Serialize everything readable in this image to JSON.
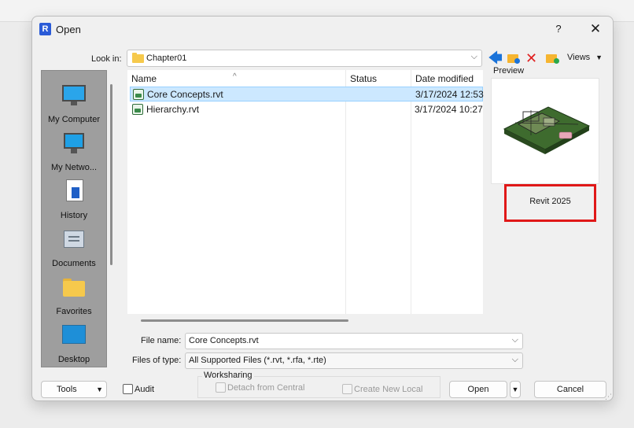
{
  "window": {
    "title": "Open",
    "help": "?",
    "close": "✕"
  },
  "lookin": {
    "label": "Look in:",
    "value": "Chapter01"
  },
  "toolbar": {
    "views_label": "Views"
  },
  "places": [
    {
      "label": "My Computer",
      "icon": "computer-icon"
    },
    {
      "label": "My Netwo...",
      "icon": "network-icon"
    },
    {
      "label": "History",
      "icon": "history-icon"
    },
    {
      "label": "Documents",
      "icon": "documents-icon"
    },
    {
      "label": "Favorites",
      "icon": "favorites-icon"
    },
    {
      "label": "Desktop",
      "icon": "desktop-icon"
    }
  ],
  "filelist": {
    "columns": {
      "name": "Name",
      "status": "Status",
      "date": "Date modified"
    },
    "rows": [
      {
        "name": "Core Concepts.rvt",
        "status": "",
        "date": "3/17/2024 12:53",
        "selected": true
      },
      {
        "name": "Hierarchy.rvt",
        "status": "",
        "date": "3/17/2024 10:27",
        "selected": false
      }
    ]
  },
  "preview": {
    "label": "Preview",
    "version": "Revit 2025"
  },
  "filename": {
    "label": "File name:",
    "value": "Core Concepts.rvt"
  },
  "filetype": {
    "label": "Files of type:",
    "value": "All Supported Files (*.rvt, *.rfa, *.rte)"
  },
  "buttons": {
    "tools": "Tools",
    "open": "Open",
    "cancel": "Cancel"
  },
  "audit": {
    "label": "Audit",
    "checked": false
  },
  "worksharing": {
    "title": "Worksharing",
    "detach_label": "Detach from Central",
    "create_label": "Create New Local"
  },
  "colors": {
    "selection": "#cce8ff",
    "highlight_border": "#e01818",
    "accent": "#1a73d9"
  }
}
